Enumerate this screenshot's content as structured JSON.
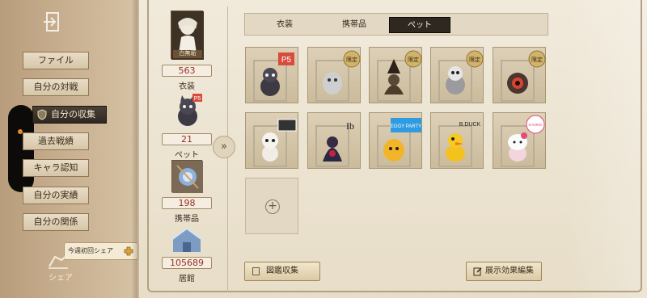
{
  "nav": {
    "items": [
      {
        "label": "ファイル"
      },
      {
        "label": "自分の対戦"
      },
      {
        "label": "自分の収集"
      },
      {
        "label": "過去戦績"
      },
      {
        "label": "キャラ認知"
      },
      {
        "label": "自分の実績"
      },
      {
        "label": "自分の関係"
      }
    ],
    "share_label": "シェア",
    "tooltip": "今週初回シェア"
  },
  "stats": {
    "costume": {
      "value": "563",
      "label": "衣装",
      "badge": "白無垢"
    },
    "pet": {
      "value": "21",
      "label": "ペット"
    },
    "accessory": {
      "value": "198",
      "label": "携帯品"
    },
    "residence": {
      "value": "105689",
      "label": "居館"
    }
  },
  "tabs": [
    {
      "label": "衣装"
    },
    {
      "label": "携帯品"
    },
    {
      "label": "ペット"
    }
  ],
  "pets": {
    "tag_limited": "限定",
    "collab_labels": {
      "persona": "P5",
      "ib": "Ib",
      "eggy": "EGGY PARTY",
      "bduck": "B.DUCK",
      "sanrio": "SANRIO"
    }
  },
  "buttons": {
    "catalog": "図鑑収集",
    "display_edit": "展示効果編集"
  },
  "colors": {
    "accent_red": "#9a2f24",
    "active_tab": "#2e2821",
    "nav_dot": "#e88a2a"
  }
}
